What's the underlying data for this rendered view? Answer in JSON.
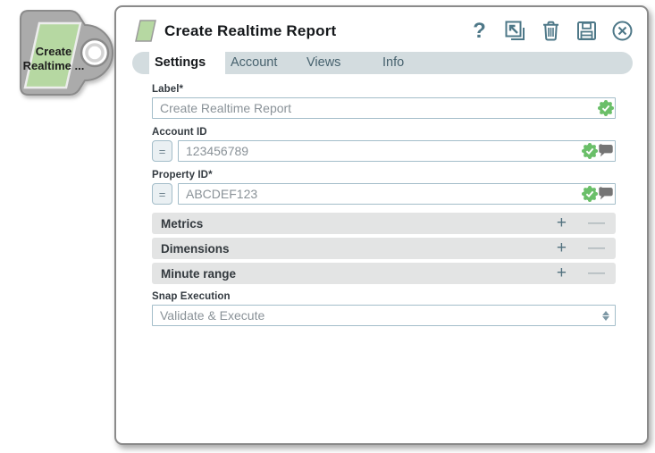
{
  "node": {
    "label_line1": "Create",
    "label_line2": "Realtime ..."
  },
  "dialog": {
    "title": "Create Realtime Report",
    "header_icons": [
      "help-icon",
      "open-in-new-icon",
      "delete-icon",
      "save-icon",
      "close-icon"
    ],
    "tabs": [
      {
        "label": "Settings",
        "active": true
      },
      {
        "label": "Account",
        "active": false
      },
      {
        "label": "Views",
        "active": false
      },
      {
        "label": "Info",
        "active": false
      }
    ],
    "fields": {
      "label": {
        "label": "Label*",
        "value": "Create Realtime Report"
      },
      "account_id": {
        "label": "Account ID",
        "value": "123456789",
        "expression_toggle": "="
      },
      "property_id": {
        "label": "Property ID*",
        "value": "ABCDEF123",
        "expression_toggle": "="
      }
    },
    "sections": [
      {
        "title": "Metrics"
      },
      {
        "title": "Dimensions"
      },
      {
        "title": "Minute range"
      }
    ],
    "section_controls": {
      "add": "+",
      "remove": "—"
    },
    "snap_execution": {
      "label": "Snap Execution",
      "value": "Validate & Execute"
    }
  },
  "colors": {
    "accent_green": "#6abf69",
    "icon_slate": "#4e7888",
    "tab_bar": "#d3dcdf",
    "accordion_bg": "#e3e4e4",
    "node_green": "#b6d8a2",
    "node_gray": "#ababab",
    "input_border": "#a3bdc9",
    "bubble_gray": "#757575"
  }
}
